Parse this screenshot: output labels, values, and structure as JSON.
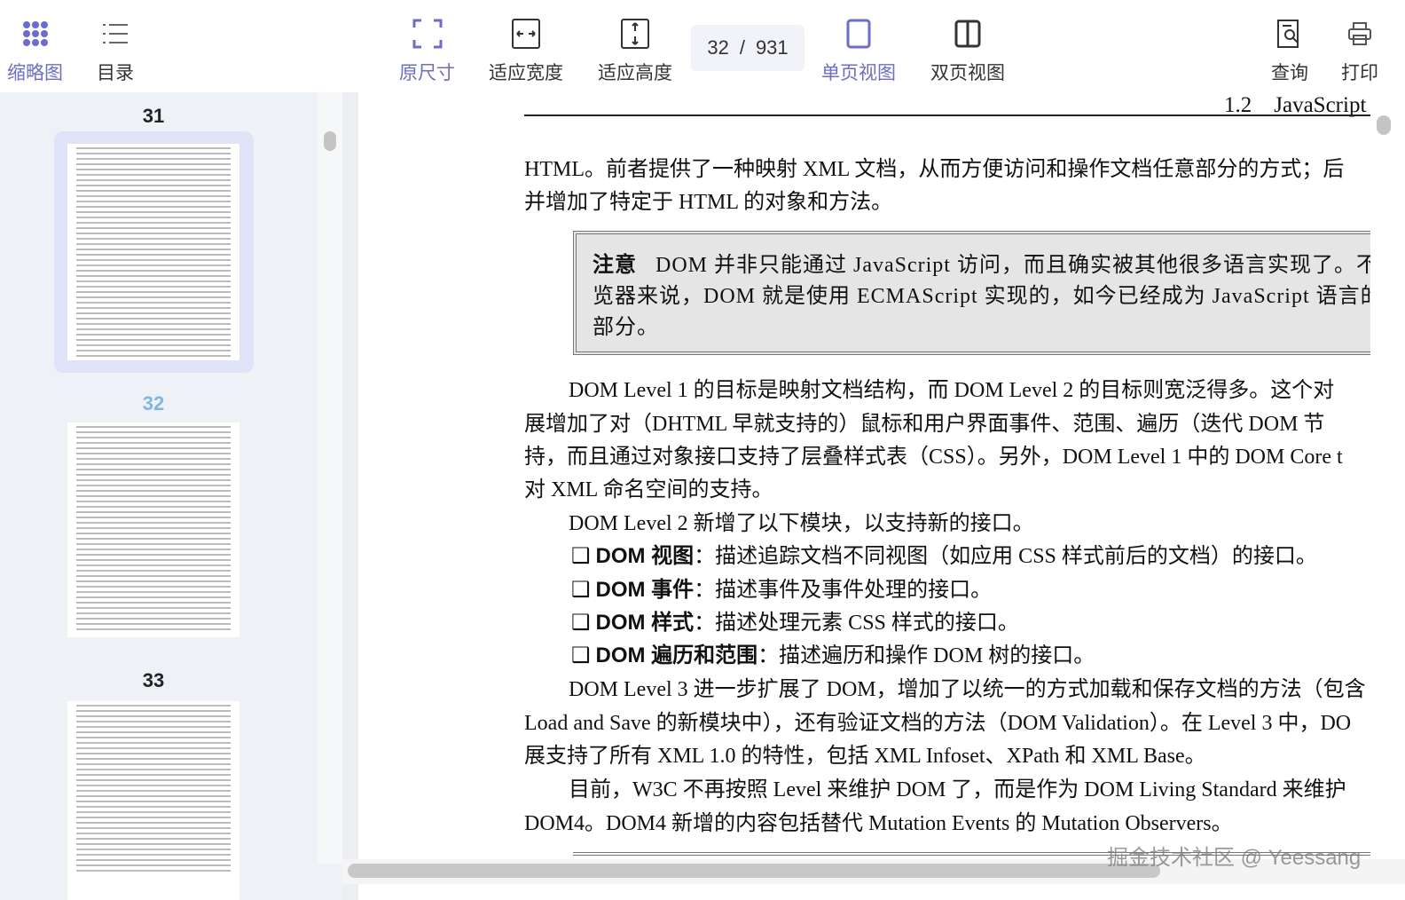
{
  "toolbar": {
    "thumbnails": "缩略图",
    "toc": "目录",
    "original_size": "原尺寸",
    "fit_width": "适应宽度",
    "fit_height": "适应高度",
    "current_page": "32",
    "separator": "/",
    "total_pages": "931",
    "single_page": "单页视图",
    "double_page": "双页视图",
    "search": "查询",
    "print": "打印",
    "accent_color": "#6b6bd6"
  },
  "sidebar": {
    "thumbs": [
      {
        "num": "31"
      },
      {
        "num": "32"
      },
      {
        "num": "33"
      }
    ]
  },
  "page": {
    "running_head": "1.2　JavaScript",
    "lines_top": [
      "HTML。前者提供了一种映射 XML 文档，从而方便访问和操作文档任意部分的方式；后",
      "并增加了特定于 HTML 的对象和方法。"
    ],
    "note": {
      "label": "注意",
      "lines": [
        "DOM 并非只能通过 JavaScript 访问，而且确实被其他很多语言实现了。不过",
        "览器来说，DOM 就是使用 ECMAScript 实现的，如今已经成为 JavaScript 语言的一",
        "部分。"
      ]
    },
    "para1": [
      "DOM Level 1 的目标是映射文档结构，而 DOM Level 2 的目标则宽泛得多。这个对",
      "展增加了对（DHTML 早就支持的）鼠标和用户界面事件、范围、遍历（迭代 DOM 节",
      "持，而且通过对象接口支持了层叠样式表（CSS）。另外，DOM Level 1 中的 DOM Core t",
      "对 XML 命名空间的支持。"
    ],
    "para2": "DOM Level 2 新增了以下模块，以支持新的接口。",
    "bullets": [
      {
        "term": "DOM 视图",
        "desc": "：描述追踪文档不同视图（如应用 CSS 样式前后的文档）的接口。"
      },
      {
        "term": "DOM 事件",
        "desc": "：描述事件及事件处理的接口。"
      },
      {
        "term": "DOM 样式",
        "desc": "：描述处理元素 CSS 样式的接口。"
      },
      {
        "term": "DOM 遍历和范围",
        "desc": "：描述遍历和操作 DOM 树的接口。"
      }
    ],
    "para3": [
      "DOM Level 3 进一步扩展了 DOM，增加了以统一的方式加载和保存文档的方法（包含",
      "Load and Save 的新模块中），还有验证文档的方法（DOM Validation）。在 Level 3 中，DO",
      "展支持了所有 XML 1.0 的特性，包括 XML Infoset、XPath 和 XML Base。"
    ],
    "para4": [
      "目前，W3C 不再按照 Level 来维护 DOM 了，而是作为 DOM Living Standard 来维护",
      "DOM4。DOM4 新增的内容包括替代 Mutation Events 的 Mutation Observers。"
    ]
  },
  "watermark": "掘金技术社区 @ Yeessang"
}
